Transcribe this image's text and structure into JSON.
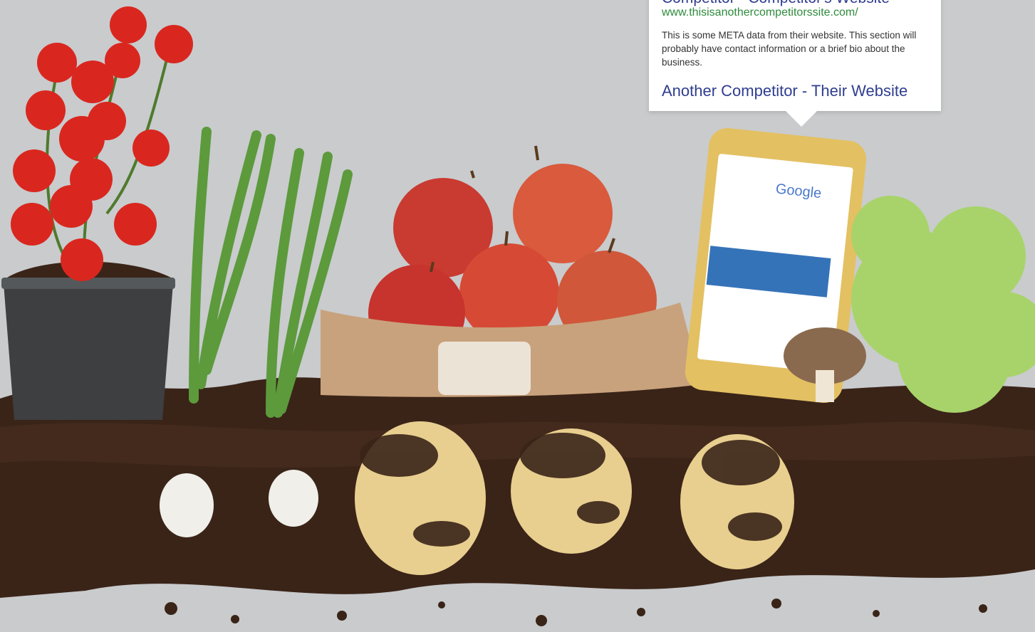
{
  "callout": {
    "first_result_title": "Competitor - Competitor's Website",
    "first_result_url": "www.thisisanothercompetitorssite.com/",
    "first_result_meta": "This is some META data from their website. This section will probably have contact information or a brief bio about the business.",
    "second_result_title": "Another Competitor - Their Website"
  },
  "phone": {
    "search_logo": "Google"
  },
  "colors": {
    "link_blue": "#2f3d8f",
    "url_green": "#2e8b3c",
    "background_gray": "#c9cbcd",
    "soil_brown": "#3a2418"
  }
}
